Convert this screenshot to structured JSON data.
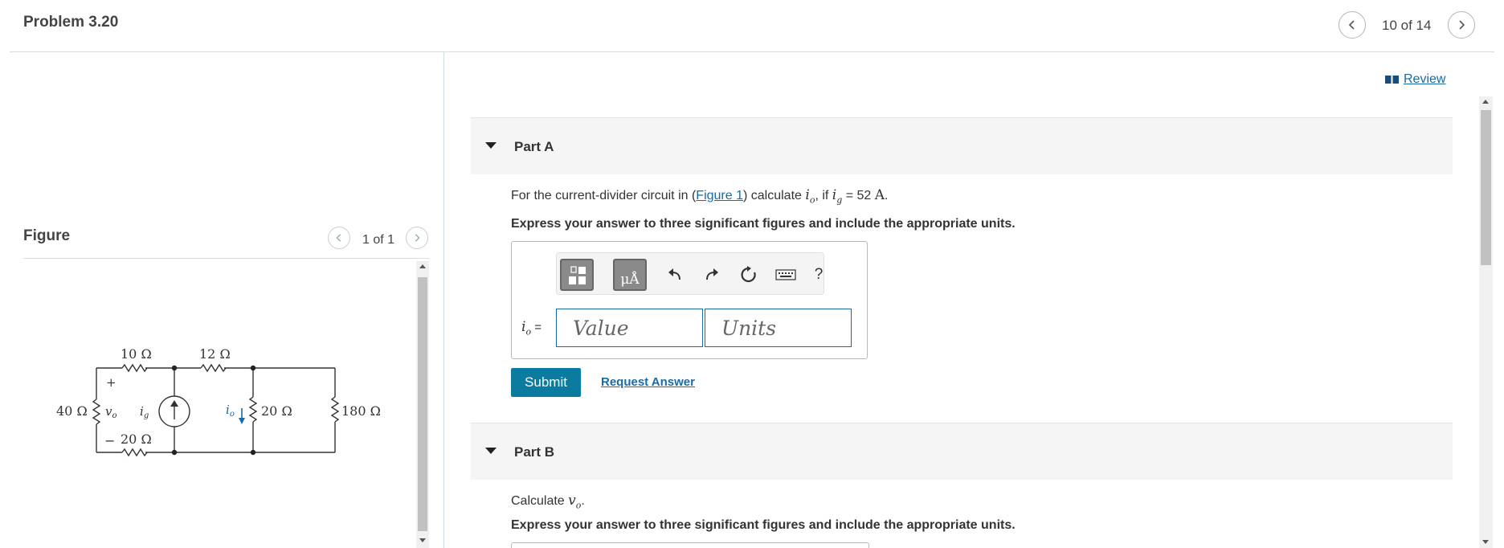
{
  "header": {
    "title": "Problem 3.20",
    "pager": "10 of 14"
  },
  "review": {
    "label": "Review"
  },
  "figure": {
    "title": "Figure",
    "pager": "1 of 1",
    "circuit": {
      "r1": "10 Ω",
      "r2": "12 Ω",
      "r3": "40 Ω",
      "r4": "20 Ω",
      "r5": "20 Ω",
      "r6": "180 Ω",
      "vo": "v",
      "vo_sub": "o",
      "ig": "i",
      "ig_sub": "g",
      "io": "i",
      "io_sub": "o",
      "plus": "+",
      "minus": "−"
    }
  },
  "part_a": {
    "label": "Part A",
    "q_prefix": "For the current-divider circuit in (",
    "q_link": "Figure 1",
    "q_mid": ") calculate ",
    "q_var": "i",
    "q_var_sub": "o",
    "q_if": ", if ",
    "q_ig": "i",
    "q_ig_sub": "g",
    "q_eq": " = 52 ",
    "q_unit": "A",
    "q_end": ".",
    "instruction": "Express your answer to three significant figures and include the appropriate units.",
    "answer_label_var": "i",
    "answer_label_sub": "o",
    "answer_label_eq": " =",
    "value_placeholder": "Value",
    "units_placeholder": "Units",
    "toolbar": {
      "units_btn_label": "μÅ",
      "help": "?"
    },
    "submit": "Submit",
    "request_answer": "Request Answer"
  },
  "part_b": {
    "label": "Part B",
    "q_prefix": "Calculate ",
    "q_var": "v",
    "q_var_sub": "o",
    "q_end": ".",
    "instruction": "Express your answer to three significant figures and include the appropriate units."
  }
}
